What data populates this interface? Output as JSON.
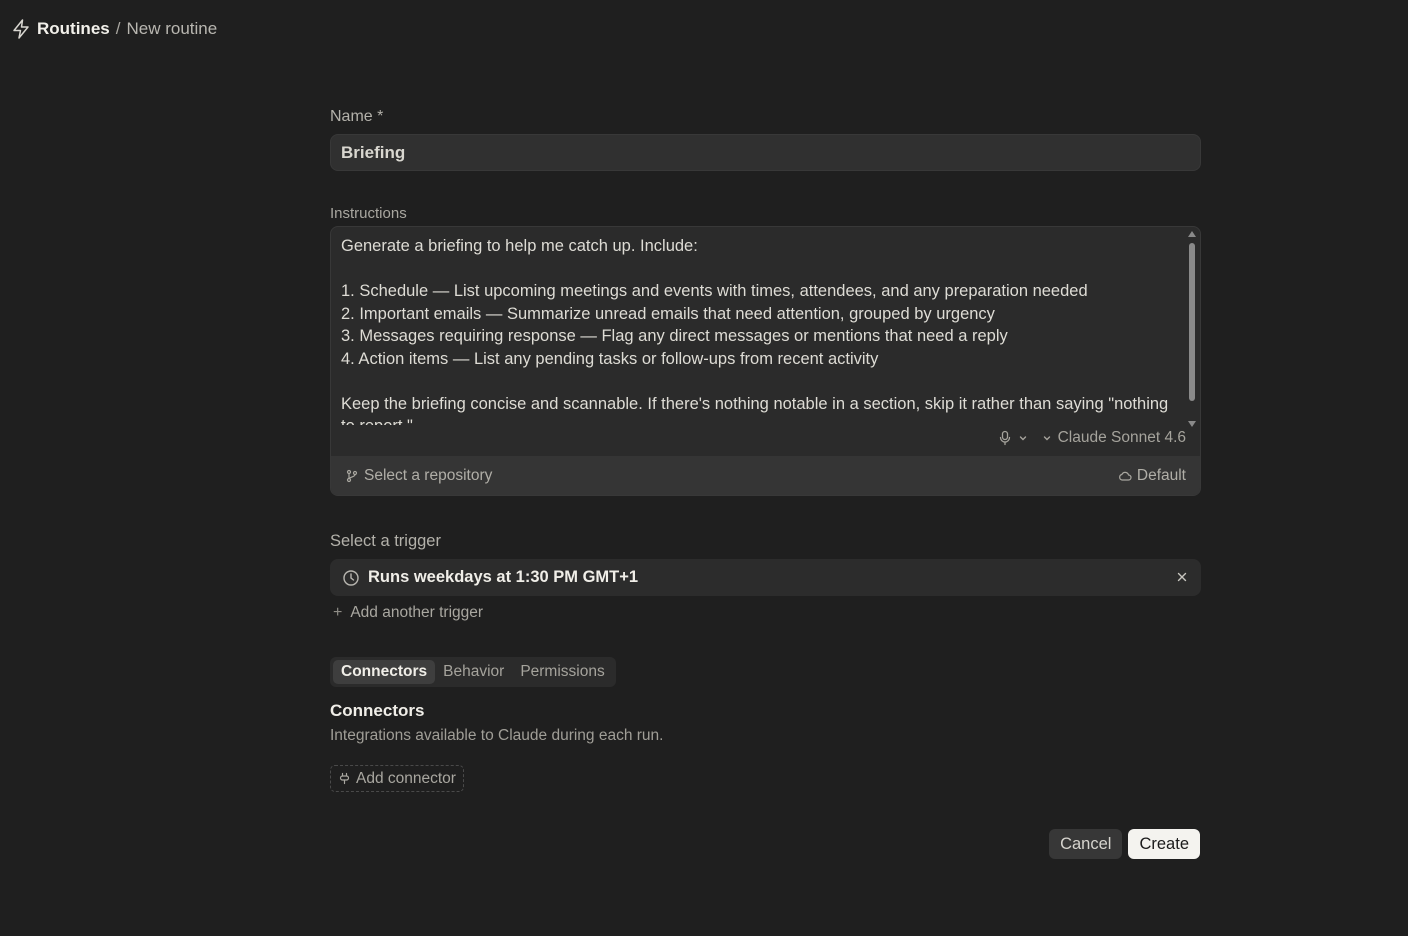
{
  "breadcrumb": {
    "icon": "lightning-icon",
    "root": "Routines",
    "separator": "/",
    "current": "New routine"
  },
  "form": {
    "name_label": "Name *",
    "name_value": "Briefing",
    "instructions_label": "Instructions",
    "instructions_value": "Generate a briefing to help me catch up. Include:\n\n1. Schedule — List upcoming meetings and events with times, attendees, and any preparation needed\n2. Important emails — Summarize unread emails that need attention, grouped by urgency\n3. Messages requiring response — Flag any direct messages or mentions that need a reply\n4. Action items — List any pending tasks or follow-ups from recent activity\n\nKeep the briefing concise and scannable. If there's nothing notable in a section, skip it rather than saying \"nothing to report.\"",
    "model": "Claude Sonnet 4.6",
    "repository_placeholder": "Select a repository",
    "environment": "Default"
  },
  "trigger": {
    "label": "Select a trigger",
    "value": "Runs weekdays at 1:30 PM GMT+1",
    "add_label": "Add another trigger"
  },
  "tabs": [
    "Connectors",
    "Behavior",
    "Permissions"
  ],
  "active_tab": "Connectors",
  "connectors": {
    "title": "Connectors",
    "description": "Integrations available to Claude during each run.",
    "add_label": "Add connector"
  },
  "actions": {
    "cancel": "Cancel",
    "create": "Create"
  }
}
